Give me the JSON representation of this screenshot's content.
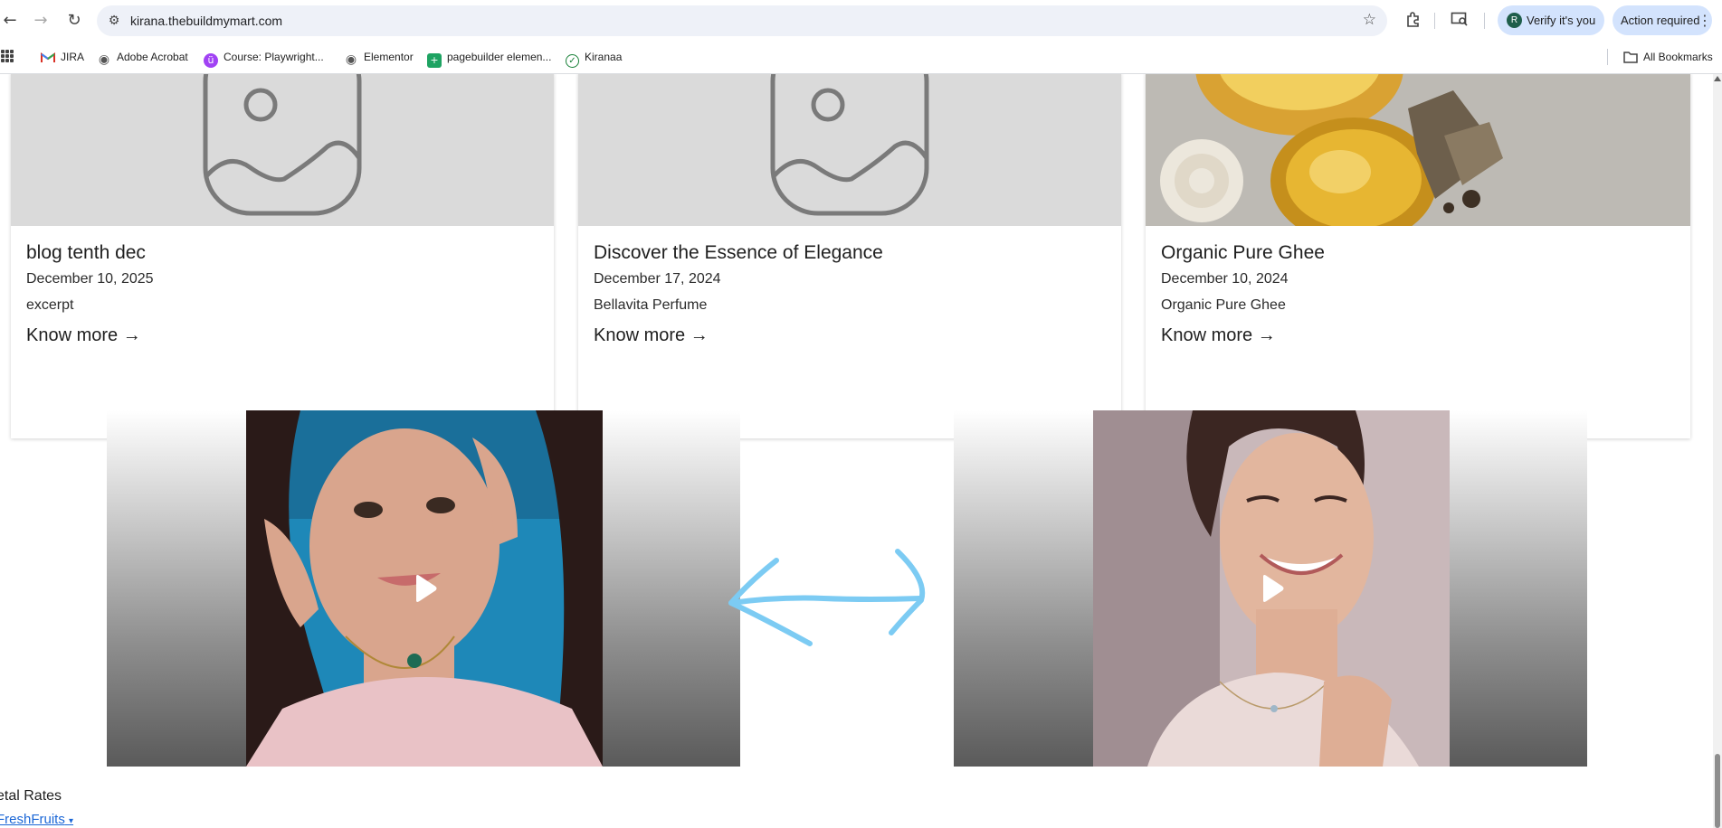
{
  "browser": {
    "url": "kirana.thebuildmymart.com",
    "verify_label": "Verify it's you",
    "verify_avatar": "R",
    "action_label": "Action required",
    "bookmarks": [
      {
        "label": "JIRA",
        "icon": "gmail-icon"
      },
      {
        "label": "Adobe Acrobat",
        "icon": "globe-icon"
      },
      {
        "label": "Course: Playwright...",
        "icon": "course-icon"
      },
      {
        "label": "Elementor",
        "icon": "globe-icon"
      },
      {
        "label": "pagebuilder elemen...",
        "icon": "sheets-icon"
      },
      {
        "label": "Kiranaa",
        "icon": "check-icon"
      }
    ],
    "all_bookmarks_label": "All Bookmarks"
  },
  "blog": {
    "posts": [
      {
        "title": "blog tenth dec",
        "date": "December 10, 2025",
        "excerpt": "excerpt",
        "link": "Know more →",
        "image": "placeholder-image"
      },
      {
        "title": "Discover the Essence of Elegance",
        "date": "December 17, 2024",
        "excerpt": "Bellavita Perfume",
        "link": "Know more →",
        "image": "placeholder-image"
      },
      {
        "title": "Organic Pure Ghee",
        "date": "December 10, 2024",
        "excerpt": "Organic Pure Ghee",
        "link": "Know more →",
        "image": "ghee-photo"
      }
    ]
  },
  "videos": [
    {
      "name": "video-1",
      "icon": "play-icon"
    },
    {
      "name": "video-2",
      "icon": "play-icon"
    }
  ],
  "annotation": {
    "icon": "double-arrow-icon",
    "color": "#7ccbf3"
  },
  "footer": {
    "metal_rates_label": "etal Rates",
    "category_dropdown": "FreshFruits"
  }
}
